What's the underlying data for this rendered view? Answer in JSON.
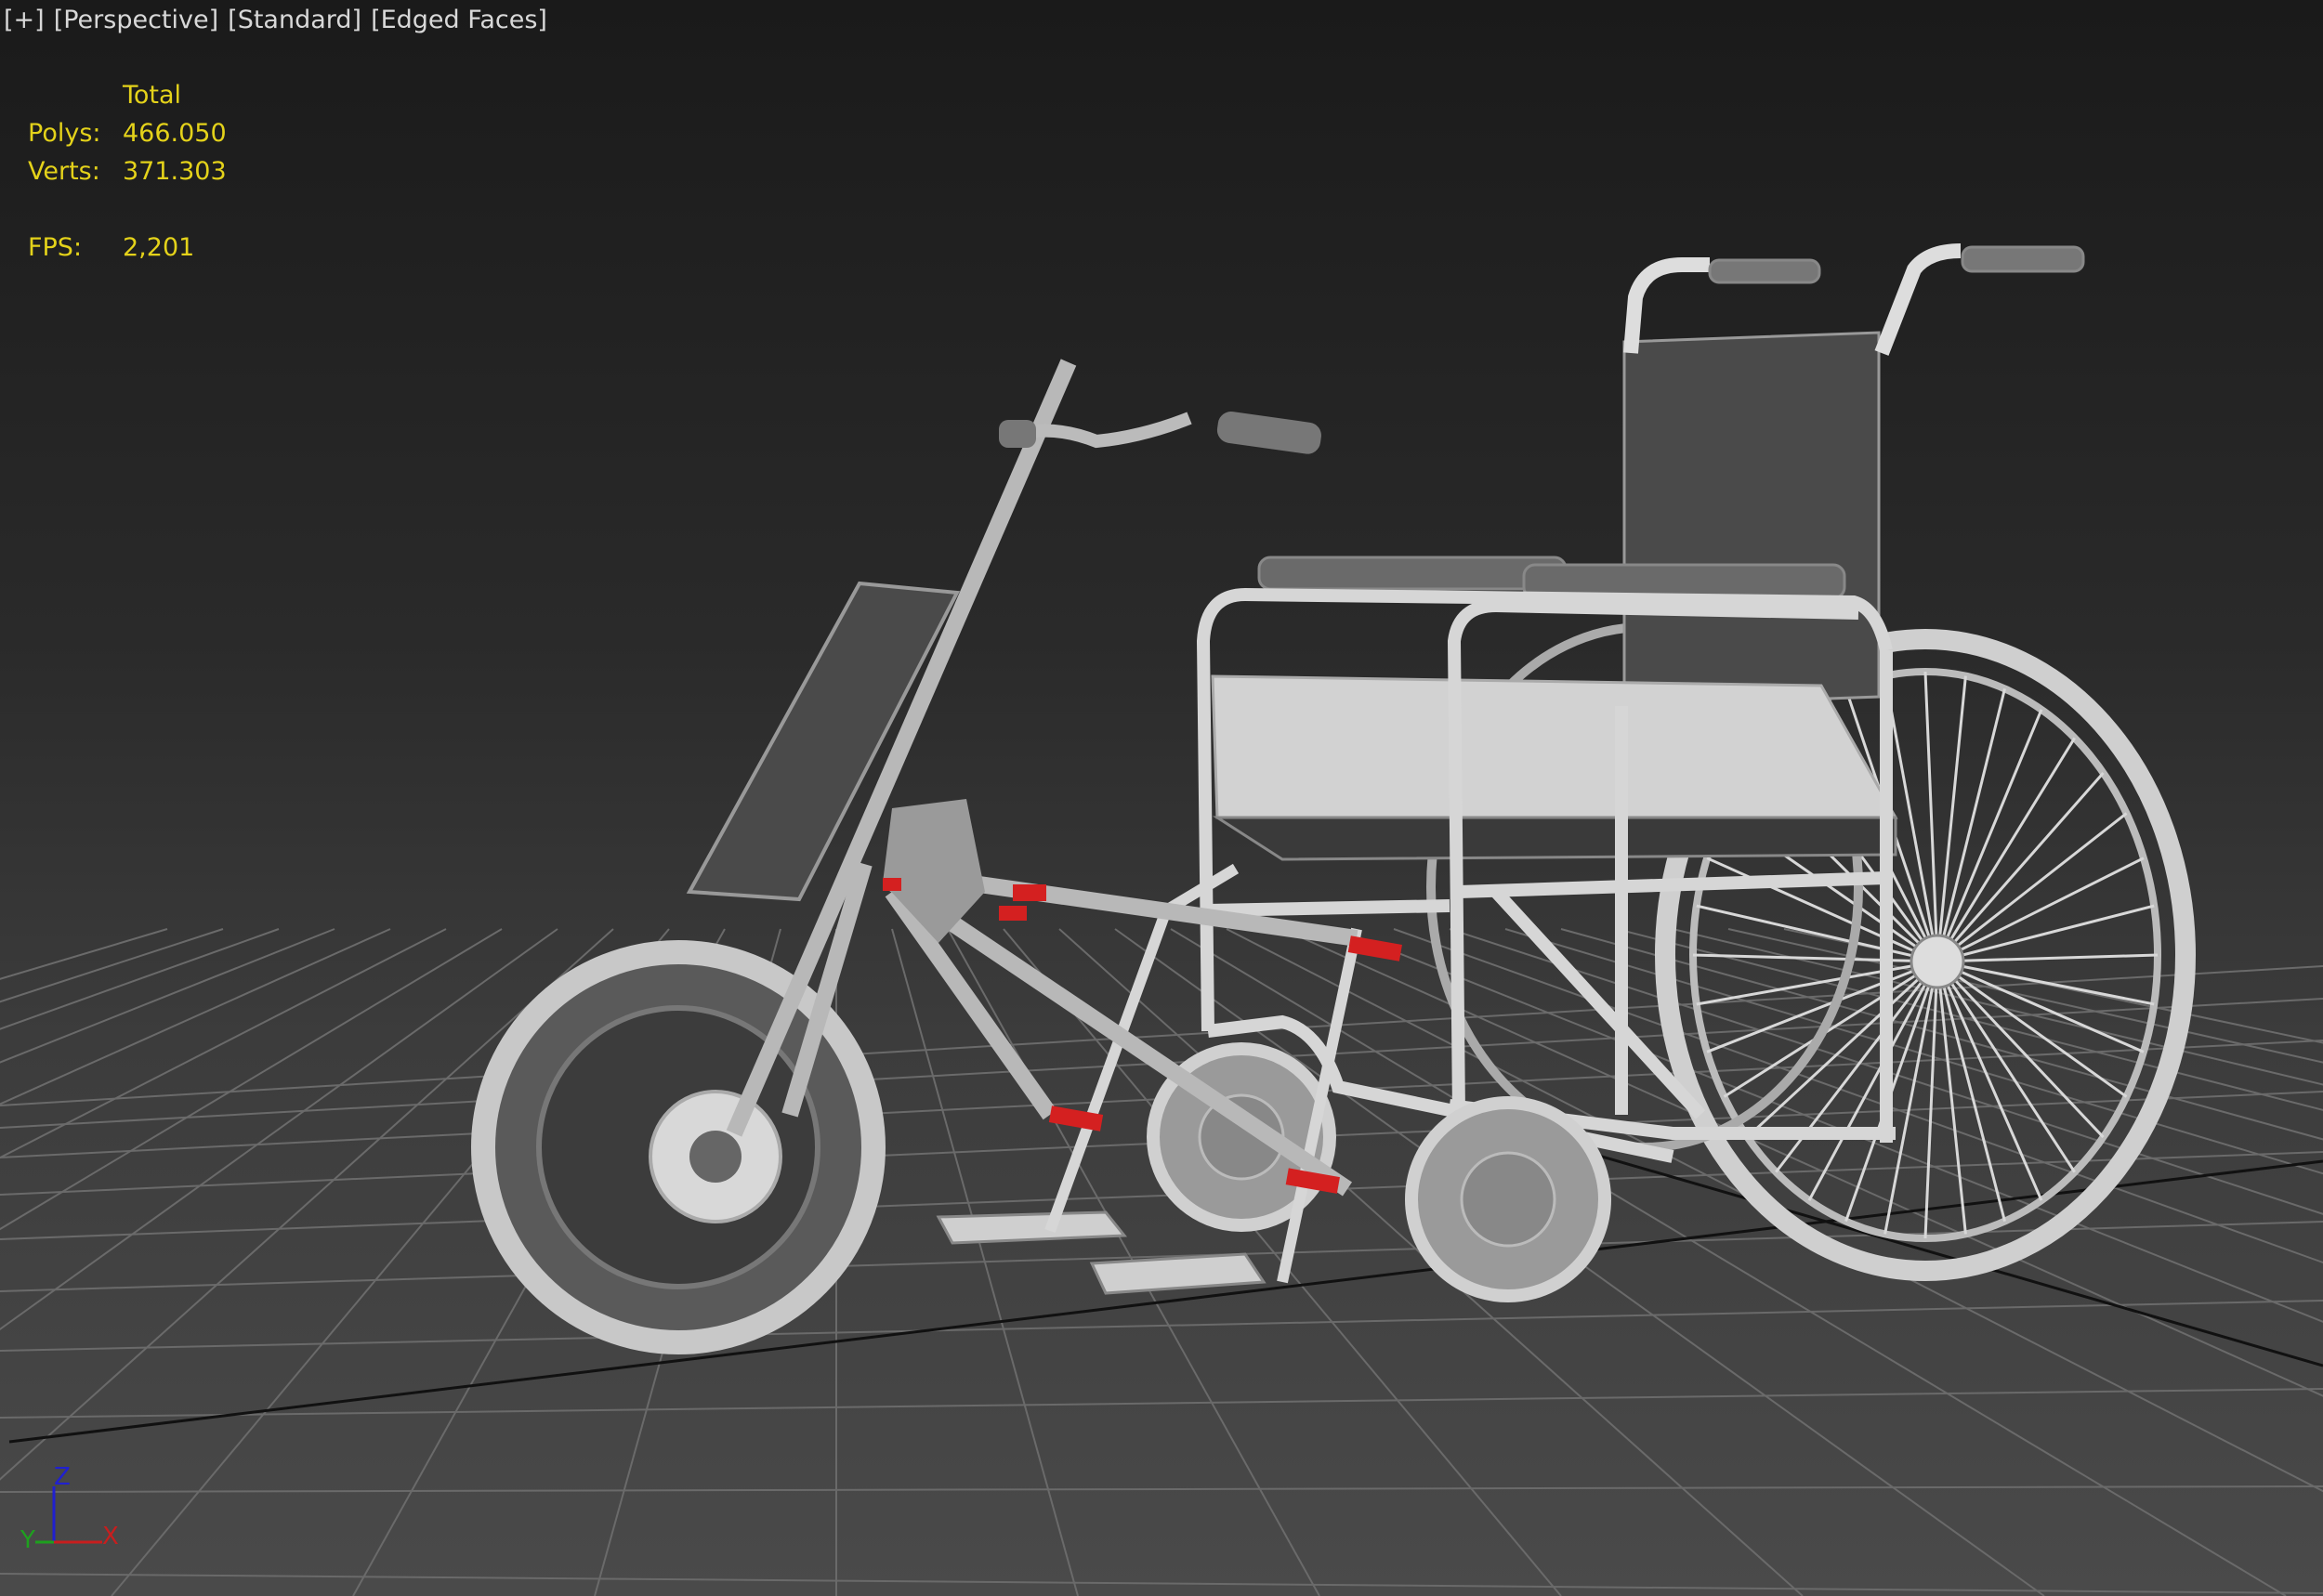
{
  "viewport": {
    "labels": [
      "[+]",
      "[Perspective]",
      "[Standard]",
      "[Edged Faces]"
    ],
    "stats": {
      "header": "Total",
      "rows": [
        {
          "key": "Polys:",
          "value": "466.050"
        },
        {
          "key": "Verts:",
          "value": "371.303"
        }
      ],
      "fps_key": "FPS:",
      "fps_value": "2,201"
    },
    "axis_tripod": {
      "x": "X",
      "y": "Y",
      "z": "Z"
    },
    "colors": {
      "stats_text": "#e4d21a",
      "label_text": "#d8d8d8",
      "axis_x": "#c81e1e",
      "axis_y": "#1ea01e",
      "axis_z": "#2020d0",
      "clamp_red": "#d42020"
    }
  }
}
